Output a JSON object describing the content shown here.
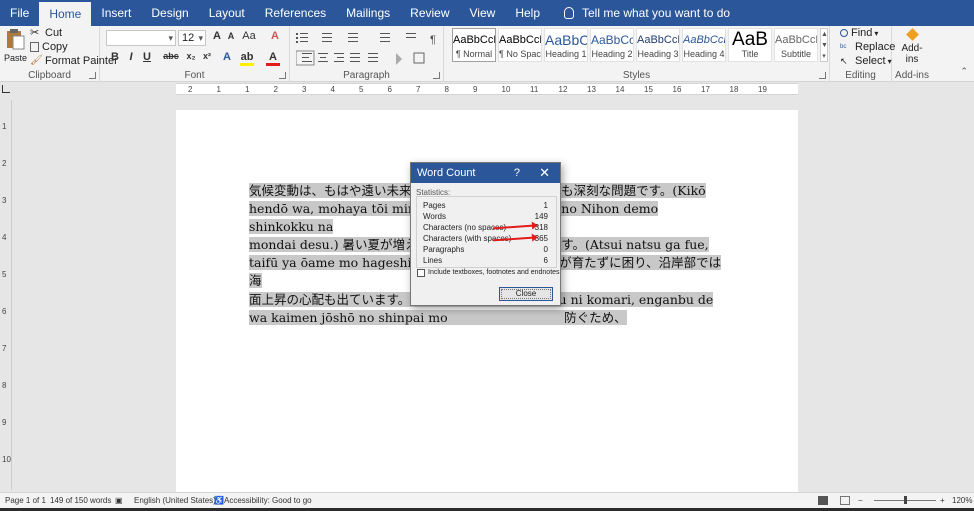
{
  "tabs": [
    "File",
    "Home",
    "Insert",
    "Design",
    "Layout",
    "References",
    "Mailings",
    "Review",
    "View",
    "Help"
  ],
  "active_tab": "Home",
  "tell_me": "Tell me what you want to do",
  "clipboard": {
    "paste": "Paste",
    "cut": "Cut",
    "copy": "Copy",
    "format_painter": "Format Painter",
    "label": "Clipboard"
  },
  "font": {
    "name": "",
    "size": "12",
    "label": "Font"
  },
  "paragraph": {
    "label": "Paragraph"
  },
  "styles": {
    "items": [
      {
        "preview": "AaBbCcDc",
        "name": "¶ Normal"
      },
      {
        "preview": "AaBbCcDc",
        "name": "¶ No Spac..."
      },
      {
        "preview": "AaBbC",
        "name": "Heading 1"
      },
      {
        "preview": "AaBbCc",
        "name": "Heading 2"
      },
      {
        "preview": "AaBbCcD",
        "name": "Heading 3"
      },
      {
        "preview": "AaBbCcD",
        "name": "Heading 4"
      },
      {
        "preview": "AaB",
        "name": "Title"
      },
      {
        "preview": "AaBbCcD",
        "name": "Subtitle"
      }
    ],
    "label": "Styles"
  },
  "editing": {
    "find": "Find",
    "replace": "Replace",
    "select": "Select",
    "label": "Editing"
  },
  "addins": {
    "button": "Add-ins",
    "label": "Add-ins"
  },
  "ruler_numbers": [
    "2",
    "1",
    "1",
    "2",
    "3",
    "4",
    "5",
    "6",
    "7",
    "8",
    "9",
    "10",
    "11",
    "12",
    "13",
    "14",
    "15",
    "16",
    "17",
    "18",
    "19"
  ],
  "vruler_numbers": [
    "1",
    "2",
    "3",
    "4",
    "5",
    "6",
    "7",
    "8",
    "9",
    "10"
  ],
  "document": {
    "lines": [
      "気候変動は、もはや遠い未来のことで　　　　　　　でも深刻な問題です。(Kikō",
      "hendō wa, mohaya tōi mirai no　　　　　　　　　 no Nihon demo shinkokku na",
      "mondai desu.) 暑い夏が増え、　　　　　　　　　います。(Atsui natsu ga fue,",
      "taifū ya ōame mo hageshiku na　　　　　　　　　が育たずに困り、沿岸部では海",
      "面上昇の心配も出ています。　　　　　　　　　odatazu ni komari, enganbu de",
      "wa kaimen jōshō no shinpai mo　　　　　　　　　 防ぐため、"
    ]
  },
  "dialog": {
    "title": "Word Count",
    "help": "?",
    "statistics": "Statistics:",
    "rows": [
      {
        "label": "Pages",
        "value": "1"
      },
      {
        "label": "Words",
        "value": "149"
      },
      {
        "label": "Characters (no spaces)",
        "value": "318"
      },
      {
        "label": "Characters (with spaces)",
        "value": "365"
      },
      {
        "label": "Paragraphs",
        "value": "0"
      },
      {
        "label": "Lines",
        "value": "6"
      }
    ],
    "checkbox": "Include textboxes, footnotes and endnotes",
    "close": "Close"
  },
  "status": {
    "page": "Page 1 of 1",
    "words": "149 of 150 words",
    "language": "English (United States)",
    "accessibility": "Accessibility: Good to go",
    "zoom": "120%"
  },
  "colors": {
    "accent": "#2b579a",
    "arrow": "#e21b1b",
    "highlight": "#c8c8c8"
  }
}
